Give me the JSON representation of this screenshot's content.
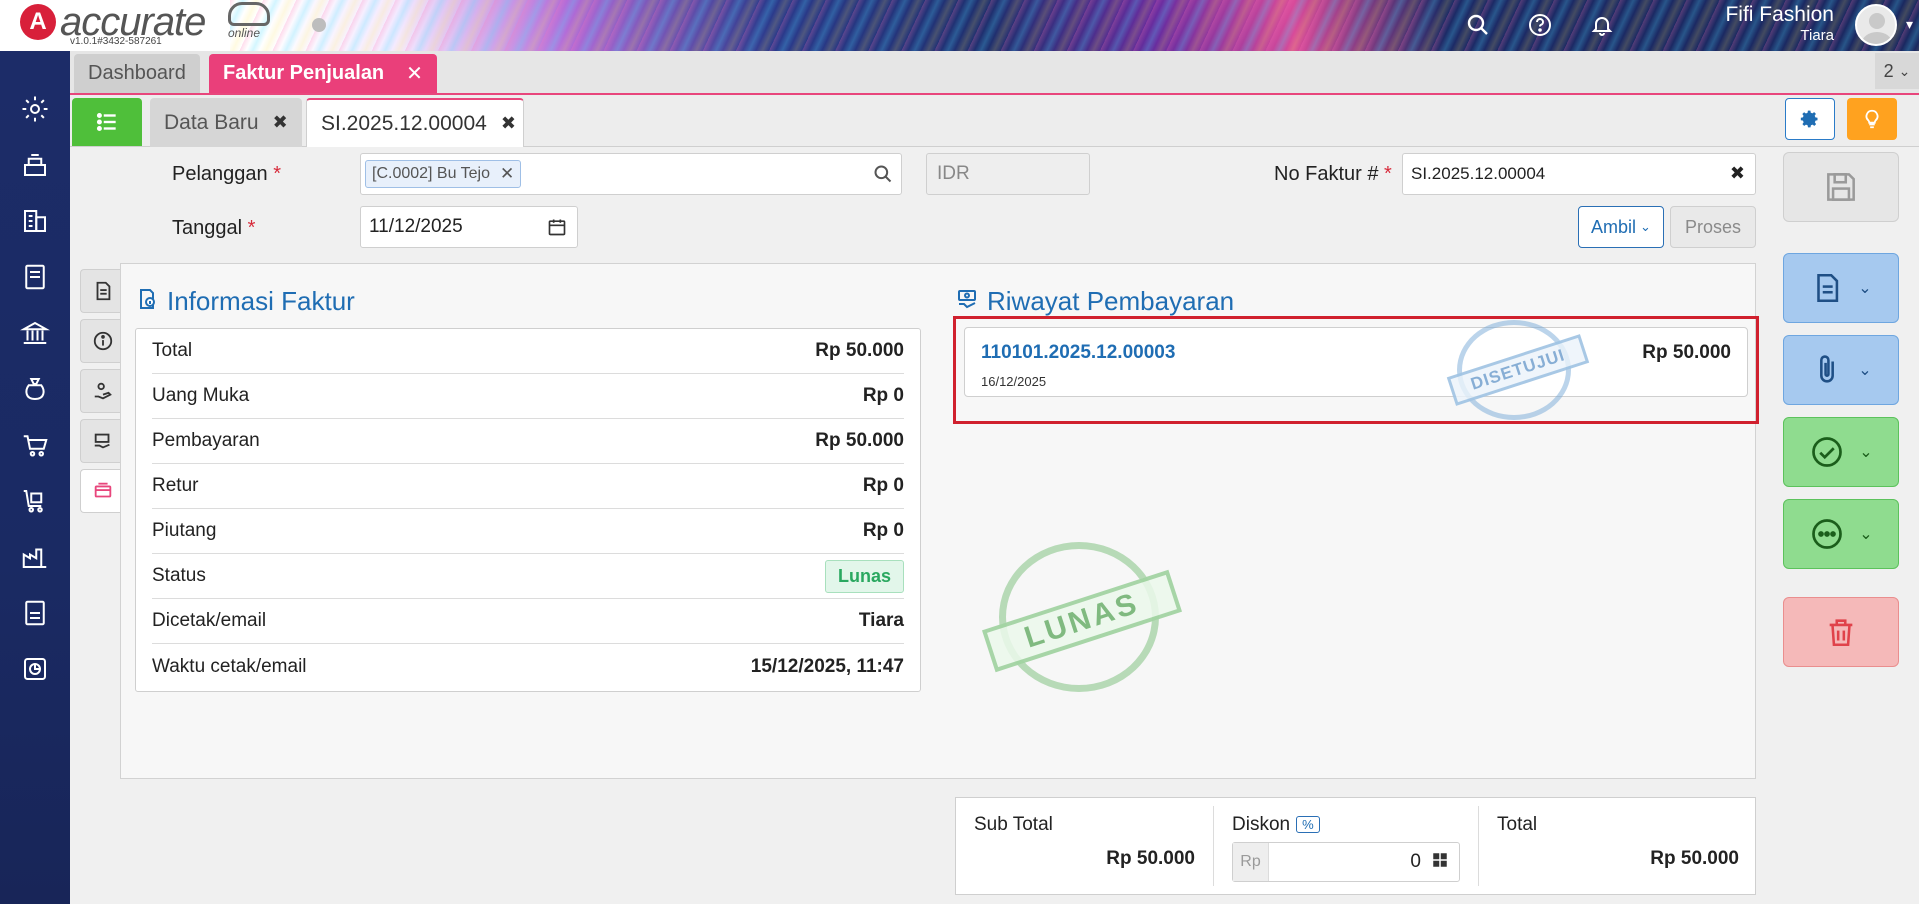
{
  "app": {
    "brand": "accurate",
    "brand_sub": "online",
    "version": "v1.0.1#3432-587261",
    "user_name": "Fifi Fashion",
    "user_sub": "Tiara"
  },
  "module_tabs": [
    {
      "label": "Dashboard"
    },
    {
      "label": "Faktur Penjualan"
    }
  ],
  "tab_count": "2",
  "doc_tabs": [
    {
      "label": "Data Baru"
    },
    {
      "label": "SI.2025.12.00004"
    }
  ],
  "form": {
    "pelanggan_label": "Pelanggan",
    "pelanggan_value": "[C.0002] Bu Tejo",
    "currency": "IDR",
    "no_faktur_label": "No Faktur #",
    "no_faktur_value": "SI.2025.12.00004",
    "tanggal_label": "Tanggal",
    "tanggal_value": "11/12/2025",
    "ambil_label": "Ambil",
    "proses_label": "Proses",
    "required_mark": "*"
  },
  "info": {
    "title": "Informasi Faktur",
    "rows": [
      {
        "label": "Total",
        "value": "Rp 50.000"
      },
      {
        "label": "Uang Muka",
        "value": "Rp 0"
      },
      {
        "label": "Pembayaran",
        "value": "Rp 50.000"
      },
      {
        "label": "Retur",
        "value": "Rp 0"
      },
      {
        "label": "Piutang",
        "value": "Rp 0"
      },
      {
        "label": "Status",
        "value": "Lunas"
      },
      {
        "label": "Dicetak/email",
        "value": "Tiara"
      },
      {
        "label": "Waktu cetak/email",
        "value": "15/12/2025, 11:47"
      }
    ]
  },
  "payment_history": {
    "title": "Riwayat Pembayaran",
    "items": [
      {
        "number": "110101.2025.12.00003",
        "date": "16/12/2025",
        "amount": "Rp 50.000"
      }
    ]
  },
  "stamps": {
    "approved": "DISETUJUI",
    "paid": "LUNAS"
  },
  "summary": {
    "subtotal_label": "Sub Total",
    "subtotal_value": "Rp 50.000",
    "diskon_label": "Diskon",
    "diskon_pct": "%",
    "diskon_prefix": "Rp",
    "diskon_value": "0",
    "total_label": "Total",
    "total_value": "Rp 50.000"
  },
  "colors": {
    "accent_pink": "#ea3f7a",
    "link_blue": "#1f6db3",
    "success_green": "#2aa860",
    "highlight_red": "#d0202e"
  }
}
